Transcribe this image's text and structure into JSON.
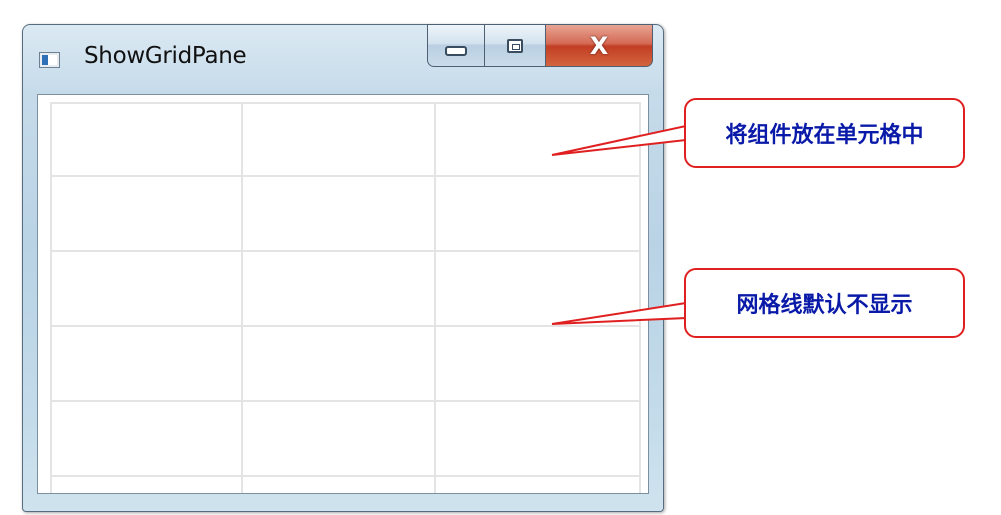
{
  "window": {
    "title": "ShowGridPane",
    "caption_buttons": {
      "minimize": "",
      "maximize": "",
      "close": "X"
    }
  },
  "grid": {
    "columns": 3,
    "rows": 5,
    "line_color": "#e4e4e4"
  },
  "annotations": [
    {
      "text": "将组件放在单元格中",
      "color": "#0a1aa8",
      "border_color": "#e02020"
    },
    {
      "text": "网格线默认不显示",
      "color": "#0a1aa8",
      "border_color": "#e02020"
    }
  ],
  "icons": {
    "app": "window-app-icon",
    "minimize": "minimize-icon",
    "maximize": "maximize-icon",
    "close": "close-icon"
  }
}
